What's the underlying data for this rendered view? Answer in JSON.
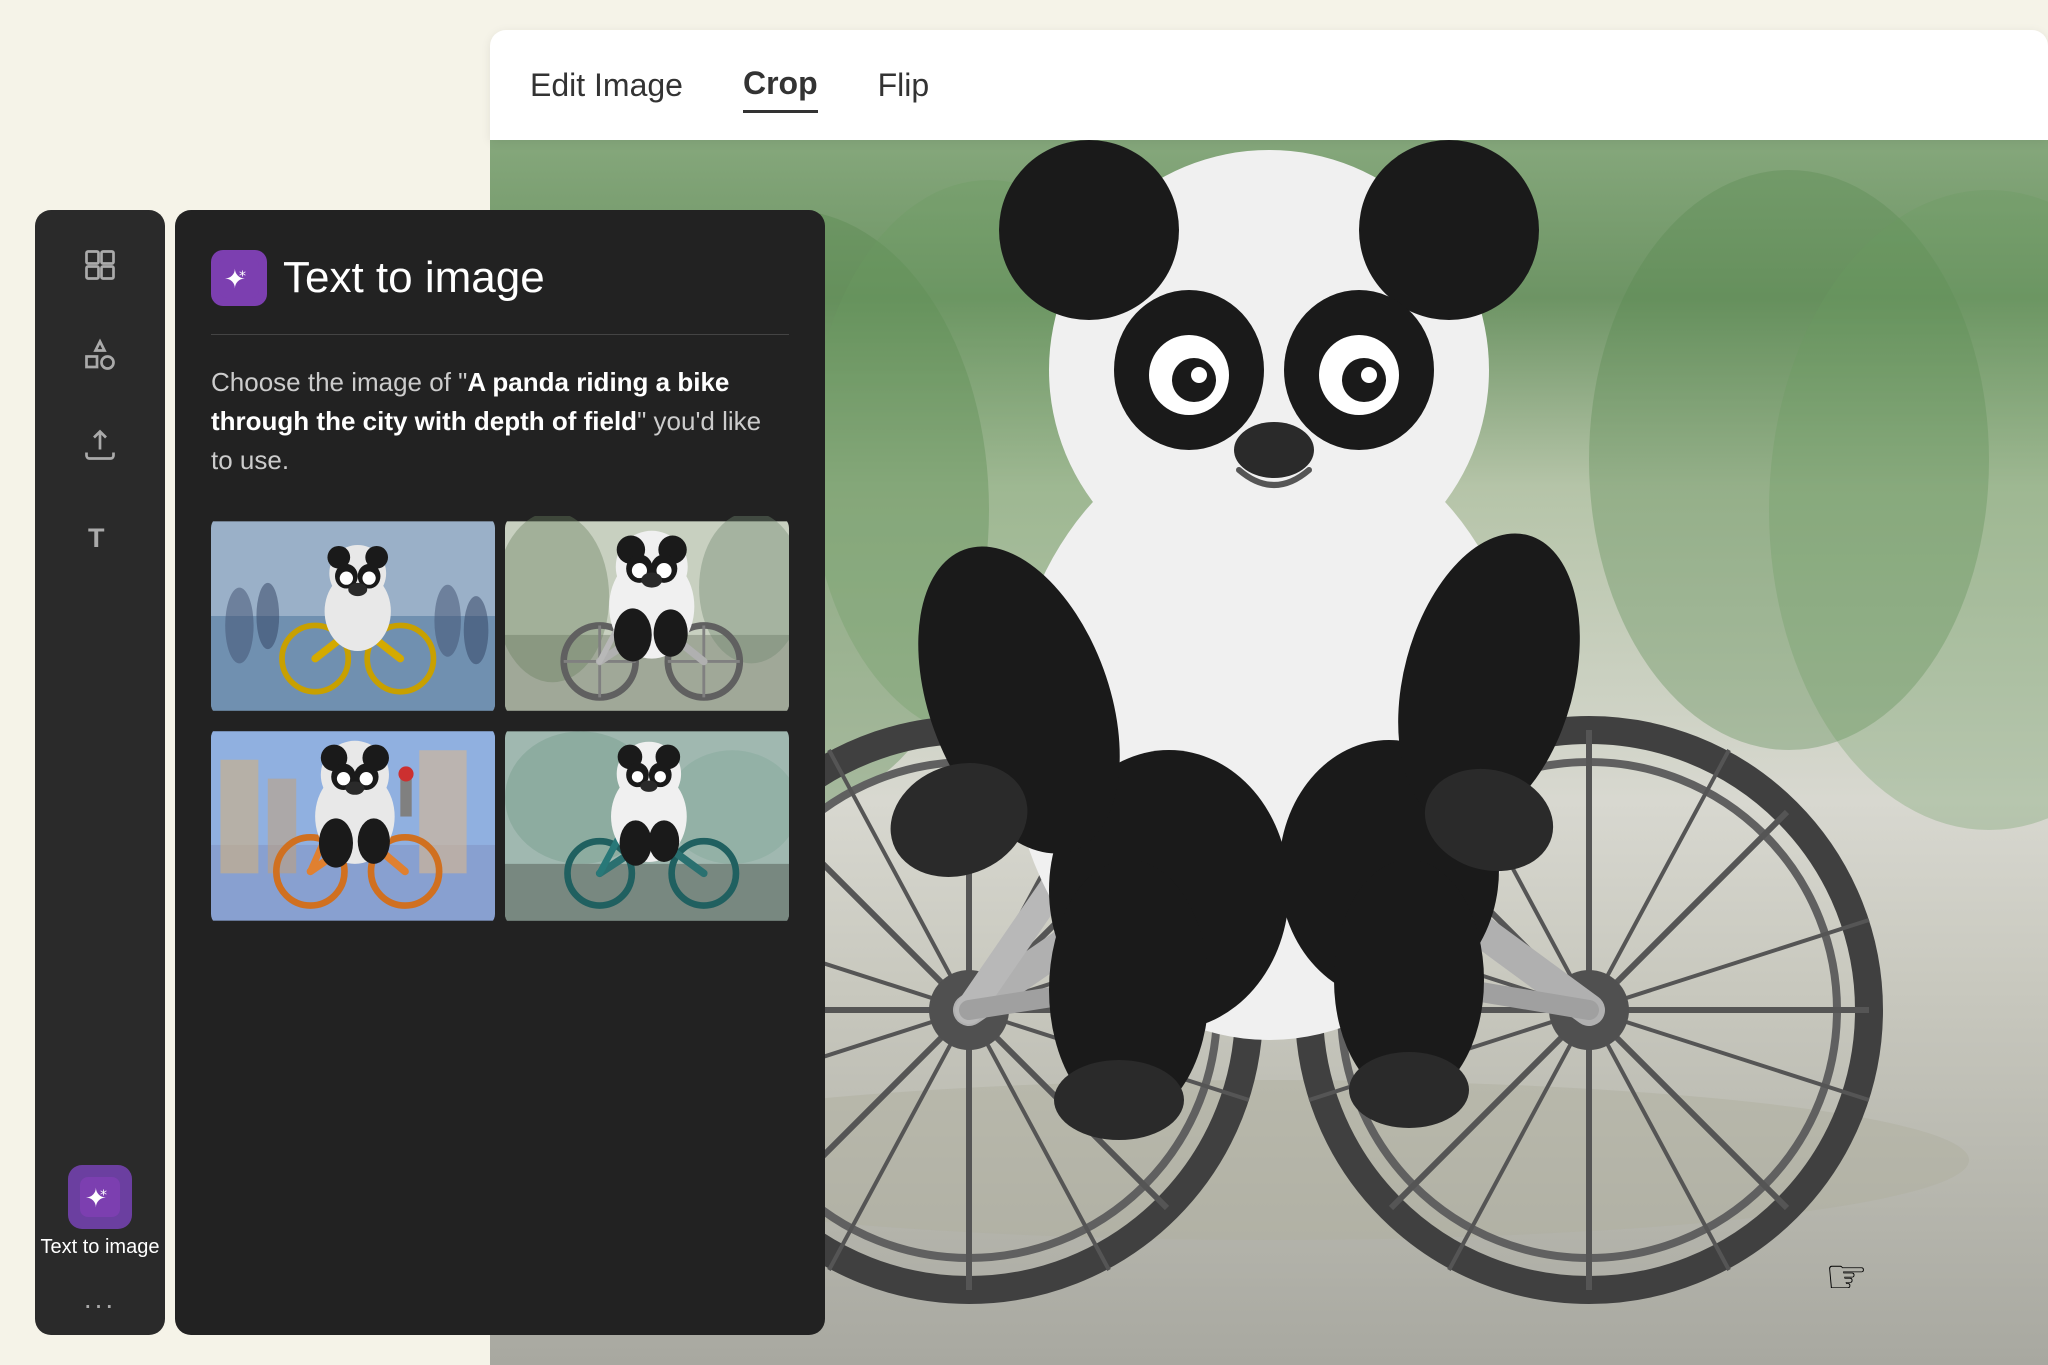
{
  "background": {
    "color": "#f5f3e8"
  },
  "toolbar": {
    "items": [
      {
        "label": "Edit Image",
        "active": false
      },
      {
        "label": "Crop",
        "active": true
      },
      {
        "label": "Flip",
        "active": false
      }
    ]
  },
  "sidebar": {
    "icons": [
      {
        "name": "layout-icon",
        "title": "Layout"
      },
      {
        "name": "elements-icon",
        "title": "Elements"
      },
      {
        "name": "upload-icon",
        "title": "Upload"
      },
      {
        "name": "text-icon",
        "title": "Text"
      }
    ],
    "textToImage": {
      "label": "Text to image",
      "iconBg": "#7c3fb0"
    },
    "more": "..."
  },
  "panel": {
    "title": "Text to image",
    "description_before": "Choose the image of “",
    "description_bold": "A panda riding a bike through the city with depth of field",
    "description_after": "” you’d like to use.",
    "iconBg": "#7c3fb0",
    "images": [
      {
        "id": 1,
        "alt": "Panda on yellow bike in city street",
        "style": "realistic-crowd"
      },
      {
        "id": 2,
        "alt": "Panda on silver bike minimal",
        "style": "clean-minimal"
      },
      {
        "id": 3,
        "alt": "Panda on orange bike colorful city",
        "style": "colorful-city"
      },
      {
        "id": 4,
        "alt": "Panda on teal bike side view",
        "style": "side-view"
      }
    ]
  },
  "mainImage": {
    "alt": "Large panda riding a sleek silver bicycle with depth of field background"
  }
}
